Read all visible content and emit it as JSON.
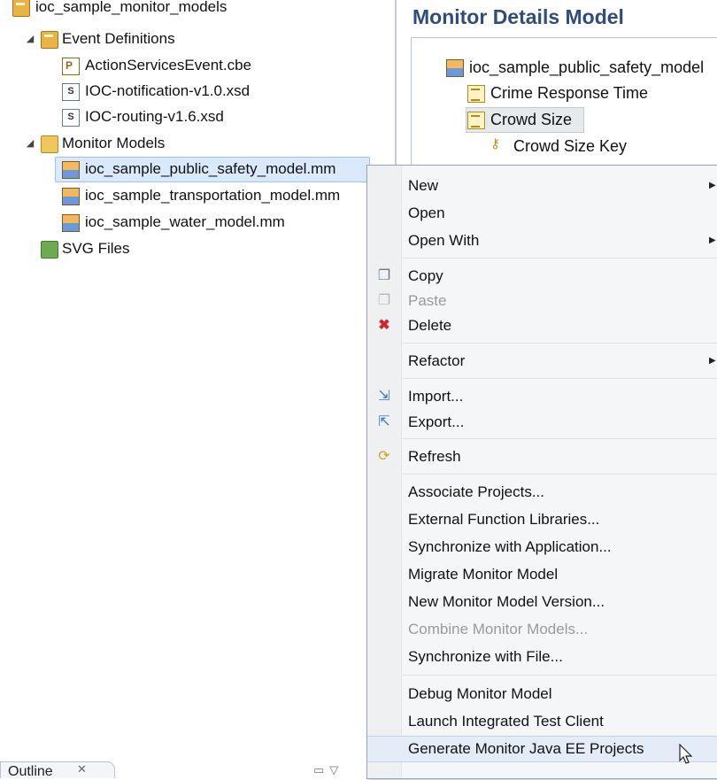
{
  "explorer": {
    "items": [
      {
        "label": "ioc_sample_monitor_models",
        "icon": "project-icon",
        "expanded": true
      },
      {
        "label": "Event Definitions",
        "icon": "package-folder-icon",
        "expanded": true
      },
      {
        "label": "ActionServicesEvent.cbe",
        "icon": "cbe-file-icon"
      },
      {
        "label": "IOC-notification-v1.0.xsd",
        "icon": "xsd-file-icon"
      },
      {
        "label": "IOC-routing-v1.6.xsd",
        "icon": "xsd-file-icon"
      },
      {
        "label": "Monitor Models",
        "icon": "monitor-models-folder-icon",
        "expanded": true
      },
      {
        "label": "ioc_sample_public_safety_model.mm",
        "icon": "monitor-model-file-icon",
        "selected": true
      },
      {
        "label": "ioc_sample_transportation_model.mm",
        "icon": "monitor-model-file-icon"
      },
      {
        "label": "ioc_sample_water_model.mm",
        "icon": "monitor-model-file-icon"
      },
      {
        "label": "SVG Files",
        "icon": "svg-folder-icon"
      }
    ]
  },
  "editor": {
    "title": "Monitor Details Model",
    "tree": [
      {
        "label": "ioc_sample_public_safety_model",
        "icon": "monitor-model-icon"
      },
      {
        "label": "Crime Response Time",
        "icon": "metric-icon"
      },
      {
        "label": "Crowd Size",
        "icon": "metric-icon",
        "highlighted": true
      },
      {
        "label": "Crowd Size Key",
        "icon": "key-icon"
      }
    ]
  },
  "outline": {
    "label": "Outline",
    "close": "✕"
  },
  "context_menu": {
    "items": [
      {
        "label": "New",
        "submenu": true
      },
      {
        "label": "Open"
      },
      {
        "label": "Open With",
        "submenu": true
      },
      {
        "label": "Copy",
        "icon": "copy-icon"
      },
      {
        "label": "Paste",
        "icon": "paste-icon",
        "disabled": true
      },
      {
        "label": "Delete",
        "icon": "delete-icon"
      },
      {
        "label": "Refactor",
        "submenu": true
      },
      {
        "label": "Import...",
        "icon": "import-icon"
      },
      {
        "label": "Export...",
        "icon": "export-icon"
      },
      {
        "label": "Refresh",
        "icon": "refresh-icon"
      },
      {
        "label": "Associate Projects..."
      },
      {
        "label": "External Function Libraries..."
      },
      {
        "label": "Synchronize with Application..."
      },
      {
        "label": "Migrate Monitor Model"
      },
      {
        "label": "New Monitor Model Version..."
      },
      {
        "label": "Combine Monitor Models...",
        "disabled": true
      },
      {
        "label": "Synchronize with File..."
      },
      {
        "label": "Debug Monitor Model"
      },
      {
        "label": "Launch Integrated Test Client"
      },
      {
        "label": "Generate Monitor Java EE Projects",
        "hover": true
      }
    ]
  },
  "colors": {
    "title": "#2f4d7a",
    "selection": "#dae9fb",
    "menu_bg": "#f5f6f7",
    "delete_icon": "#d0262a"
  }
}
